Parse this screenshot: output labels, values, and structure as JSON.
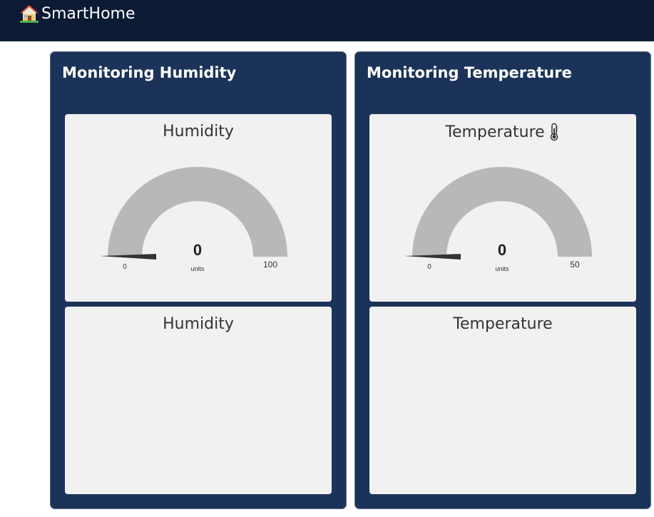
{
  "app": {
    "title": "SmartHome",
    "icon": "house-icon"
  },
  "panels": [
    {
      "title": "Monitoring Humidity",
      "gauge": {
        "title": "Humidity",
        "value": "0",
        "units": "units",
        "min": "0",
        "max": "100",
        "fraction": 0,
        "icon": ""
      },
      "chart": {
        "title": "Humidity"
      }
    },
    {
      "title": "Monitoring Temperature",
      "gauge": {
        "title": "Temperature",
        "value": "0",
        "units": "units",
        "min": "0",
        "max": "50",
        "fraction": 0,
        "icon": "thermometer-icon"
      },
      "chart": {
        "title": "Temperature"
      }
    }
  ],
  "colors": {
    "topbar": "#0c1a33",
    "panel": "#1b3358",
    "card": "#f1f1f1",
    "gauge_track": "#b8b8b8",
    "needle": "#333333"
  }
}
